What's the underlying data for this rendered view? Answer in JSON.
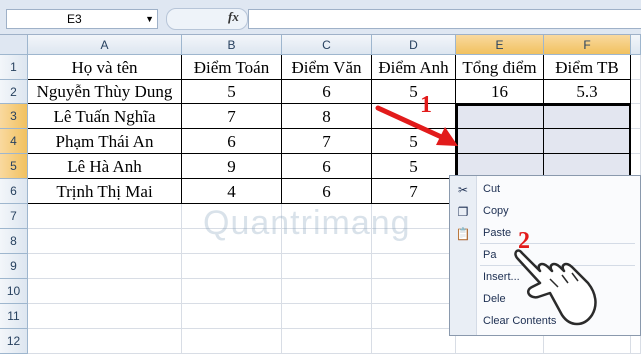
{
  "name_box": "E3",
  "fx_label": "fx",
  "columns": [
    "A",
    "B",
    "C",
    "D",
    "E",
    "F"
  ],
  "rows": [
    "1",
    "2",
    "3",
    "4",
    "5",
    "6",
    "7",
    "8",
    "9",
    "10",
    "11",
    "12"
  ],
  "table": [
    [
      "Họ và tên",
      "Điểm Toán",
      "Điểm Văn",
      "Điểm Anh",
      "Tổng điểm",
      "Điểm TB"
    ],
    [
      "Nguyễn Thùy Dung",
      "5",
      "6",
      "5",
      "16",
      "5.3"
    ],
    [
      "Lê Tuấn Nghĩa",
      "7",
      "8",
      "",
      "",
      ""
    ],
    [
      "Phạm Thái An",
      "6",
      "7",
      "5",
      "",
      ""
    ],
    [
      "Lê Hà Anh",
      "9",
      "6",
      "5",
      "",
      ""
    ],
    [
      "Trịnh Thị Mai",
      "4",
      "6",
      "7",
      "",
      ""
    ]
  ],
  "context_menu": [
    {
      "label": "Cut",
      "icon": "scissors-icon"
    },
    {
      "label": "Copy",
      "icon": "copy-icon"
    },
    {
      "label": "Paste",
      "icon": "paste-icon"
    },
    {
      "label": "Pa",
      "icon": ""
    },
    {
      "label": "Insert...",
      "icon": ""
    },
    {
      "label": "Dele",
      "icon": ""
    },
    {
      "label": "Clear Contents",
      "icon": ""
    }
  ],
  "annotations": {
    "step1": "1",
    "step2": "2"
  },
  "watermark": "Quantrimang",
  "colors": {
    "header_bg": "#dfe7f2",
    "selected_header": "#f1c15f",
    "selection_fill": "#e3e6f0",
    "annotation_red": "#e21b1b"
  }
}
